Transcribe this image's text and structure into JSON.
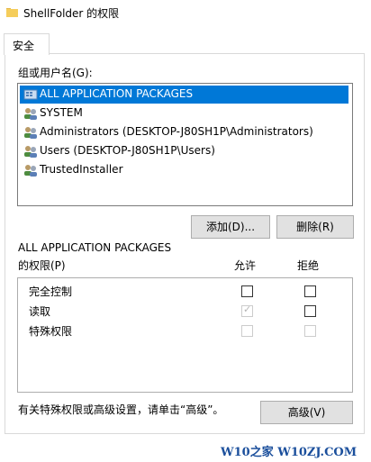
{
  "window": {
    "title": "ShellFolder 的权限"
  },
  "tabs": [
    {
      "label": "安全"
    }
  ],
  "group_label": "组或用户名(G):",
  "principals": [
    {
      "name": "ALL APPLICATION PACKAGES",
      "selected": true,
      "icon": "app-packages-icon"
    },
    {
      "name": "SYSTEM",
      "selected": false,
      "icon": "users-icon"
    },
    {
      "name": "Administrators (DESKTOP-J80SH1P\\Administrators)",
      "selected": false,
      "icon": "users-icon"
    },
    {
      "name": "Users (DESKTOP-J80SH1P\\Users)",
      "selected": false,
      "icon": "users-icon"
    },
    {
      "name": "TrustedInstaller",
      "selected": false,
      "icon": "users-icon"
    }
  ],
  "buttons": {
    "add": "添加(D)...",
    "remove": "删除(R)",
    "advanced": "高级(V)"
  },
  "permissions": {
    "for_label": "ALL APPLICATION PACKAGES",
    "subtitle": "的权限(P)",
    "allow_header": "允许",
    "deny_header": "拒绝",
    "rows": [
      {
        "name": "完全控制",
        "allow": false,
        "deny": false,
        "enabled": true
      },
      {
        "name": "读取",
        "allow": true,
        "deny": false,
        "enabled": true,
        "allow_disabled": true
      },
      {
        "name": "特殊权限",
        "allow": false,
        "deny": false,
        "enabled": false
      }
    ]
  },
  "advanced_hint": "有关特殊权限或高级设置，请单击“高级”。",
  "watermark": "W10之家 W10ZJ.COM",
  "colors": {
    "selection": "#0078d7",
    "button_bg": "#e1e1e1",
    "watermark": "#1b4f9c"
  }
}
